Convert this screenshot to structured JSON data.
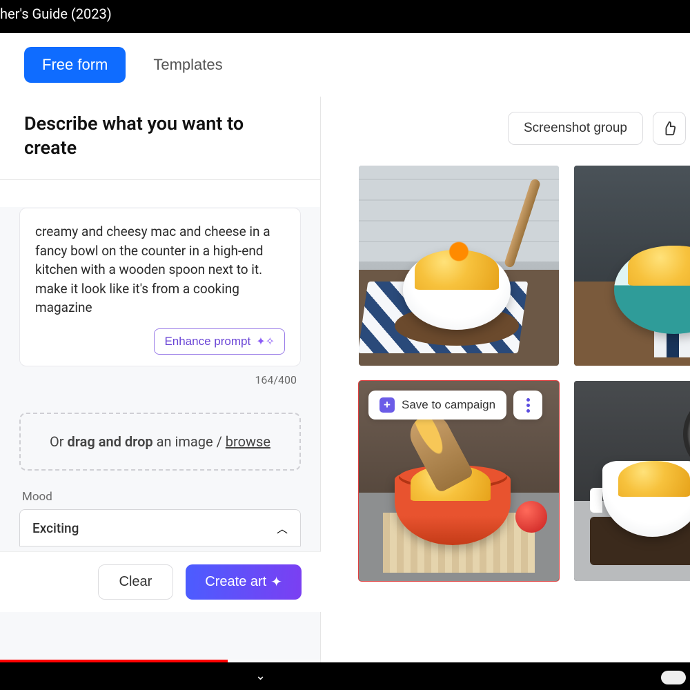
{
  "video": {
    "title_fragment": "her's Guide (2023)",
    "progress_percent": 33
  },
  "tabs": {
    "free_form": "Free form",
    "templates": "Templates"
  },
  "left": {
    "heading": "Describe what you want to create",
    "prompt_value": "creamy and cheesy mac and cheese in a fancy bowl on the counter in a high-end kitchen with a wooden spoon next to it. make it look like it's from a cooking magazine",
    "enhance_label": "Enhance prompt",
    "char_count": "164/400",
    "drop_prefix": "Or ",
    "drop_bold": "drag and drop",
    "drop_mid": " an image / ",
    "drop_link": "browse",
    "mood_label": "Mood",
    "mood_value": "Exciting",
    "clear_label": "Clear",
    "create_label": "Create art"
  },
  "right": {
    "screenshot_group": "Screenshot group",
    "save_campaign": "Save to campaign"
  }
}
